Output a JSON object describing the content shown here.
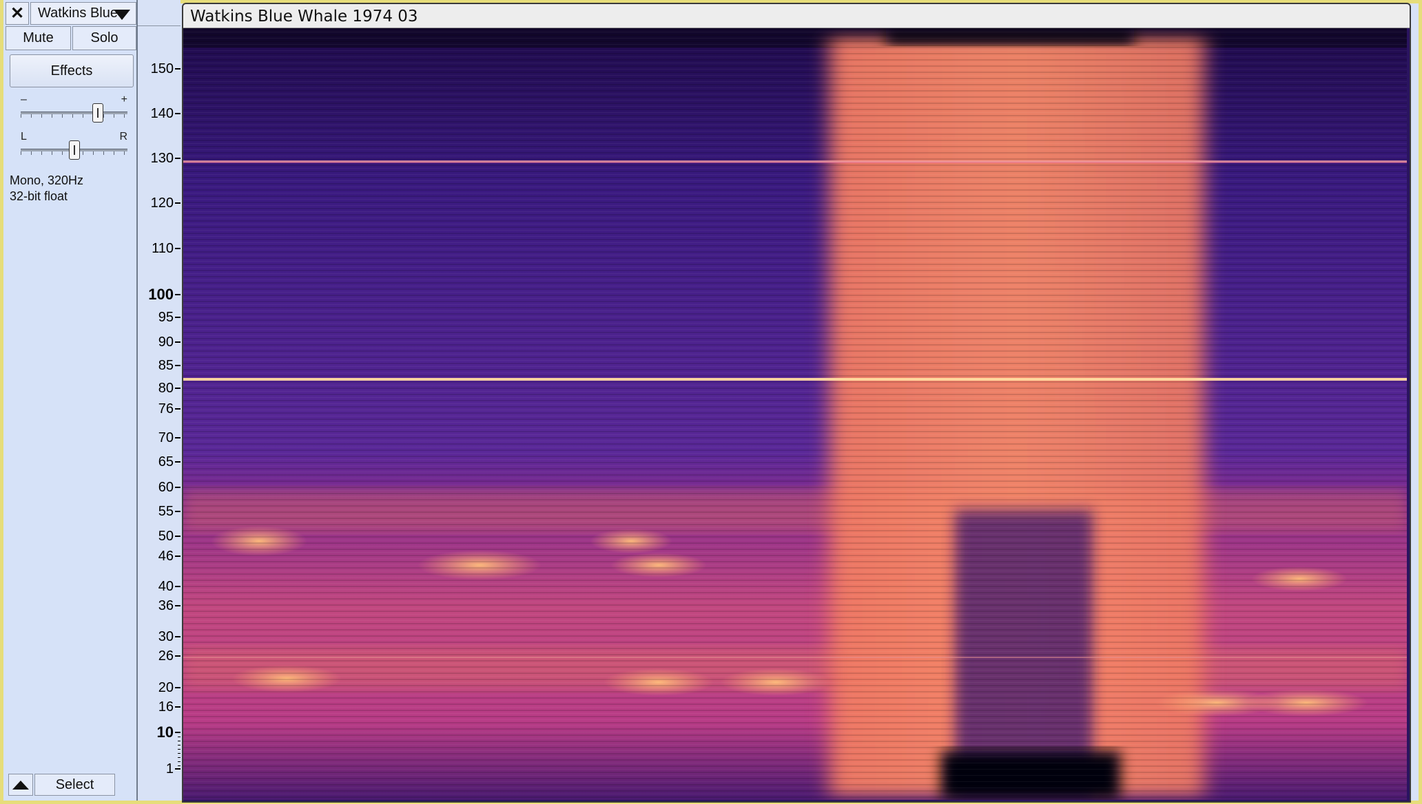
{
  "track_control": {
    "close_icon": "close-icon",
    "track_name": "Watkins Blue",
    "mute_label": "Mute",
    "solo_label": "Solo",
    "effects_label": "Effects",
    "gain_minus": "–",
    "gain_plus": "+",
    "pan_left": "L",
    "pan_right": "R",
    "info_rate": "Mono, 320Hz",
    "info_format": "32-bit float",
    "collapse_icon": "collapse-arrow-icon",
    "select_label": "Select"
  },
  "spectrogram": {
    "title": "Watkins Blue Whale 1974 03",
    "scale_labels": [
      "150",
      "140",
      "130",
      "120",
      "110",
      "100",
      "95",
      "90",
      "85",
      "80",
      "76",
      "70",
      "65",
      "60",
      "55",
      "50",
      "46",
      "40",
      "36",
      "30",
      "26",
      "20",
      "16",
      "10",
      "1"
    ],
    "major_labels": [
      "100",
      "10"
    ],
    "colormap": [
      "#1a0535",
      "#3a1a7a",
      "#6a2a9a",
      "#b0388c",
      "#e8605a",
      "#ffb070"
    ]
  }
}
